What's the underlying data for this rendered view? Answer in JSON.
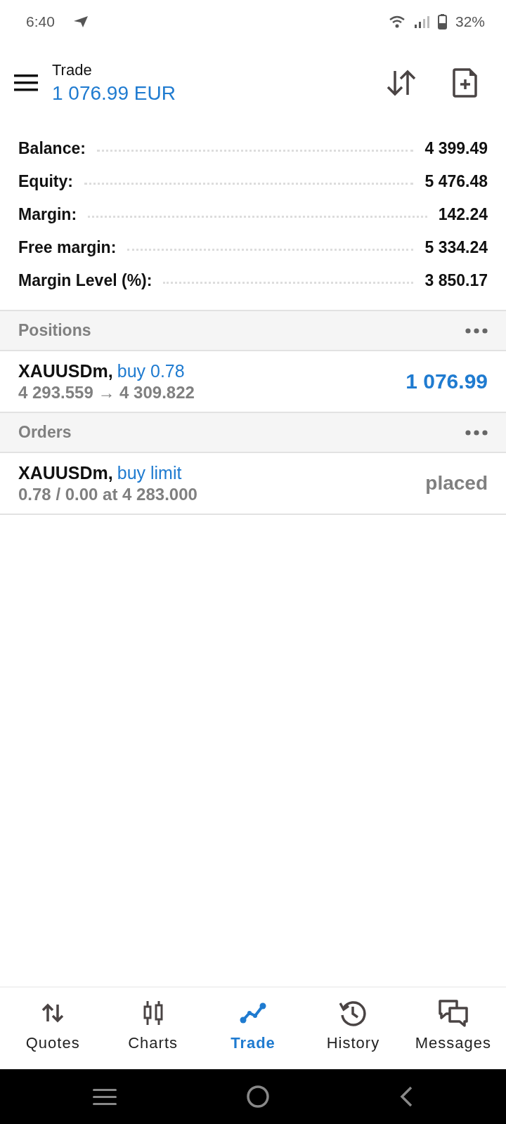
{
  "status_bar": {
    "time": "6:40",
    "battery": "32%"
  },
  "header": {
    "title": "Trade",
    "balance": "1 076.99 EUR"
  },
  "summary": [
    {
      "label": "Balance:",
      "value": "4 399.49"
    },
    {
      "label": "Equity:",
      "value": "5 476.48"
    },
    {
      "label": "Margin:",
      "value": "142.24"
    },
    {
      "label": "Free margin:",
      "value": "5 334.24"
    },
    {
      "label": "Margin Level (%):",
      "value": "3 850.17"
    }
  ],
  "sections": [
    {
      "title": "Positions",
      "items": [
        {
          "kind": "position",
          "symbol": "XAUUSDm,",
          "action": "buy 0.78",
          "detail": "4 293.559 → 4 309.822",
          "result": "1 076.99"
        }
      ]
    },
    {
      "title": "Orders",
      "items": [
        {
          "kind": "order",
          "symbol": "XAUUSDm,",
          "action": "buy limit",
          "detail": "0.78 / 0.00 at 4 283.000",
          "result": "placed"
        }
      ]
    }
  ],
  "tabs": [
    {
      "label": "Quotes",
      "selected": false
    },
    {
      "label": "Charts",
      "selected": false
    },
    {
      "label": "Trade",
      "selected": true
    },
    {
      "label": "History",
      "selected": false
    },
    {
      "label": "Messages",
      "selected": false
    }
  ]
}
